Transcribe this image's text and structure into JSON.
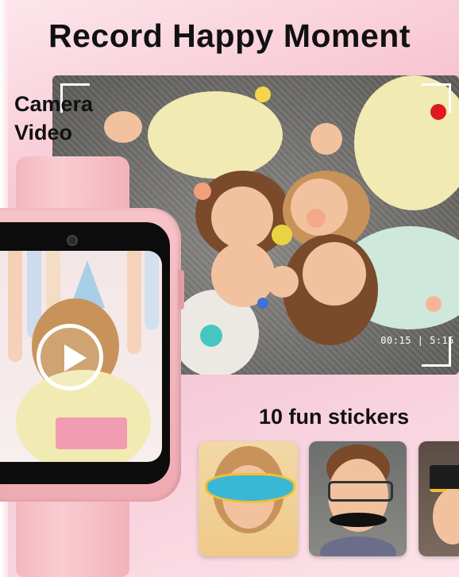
{
  "headline": "Record Happy Moment",
  "camera_label": [
    "Camera",
    "Video"
  ],
  "timecode": "00:15 | 5:15",
  "stickers_title": "10 fun stickers",
  "colors": {
    "background": "#f7cfd8",
    "watch_pink": "#f4b8bf",
    "record_dot": "#e0191e"
  },
  "icons": [
    "record-dot-icon",
    "play-icon",
    "watch-camera-icon"
  ]
}
